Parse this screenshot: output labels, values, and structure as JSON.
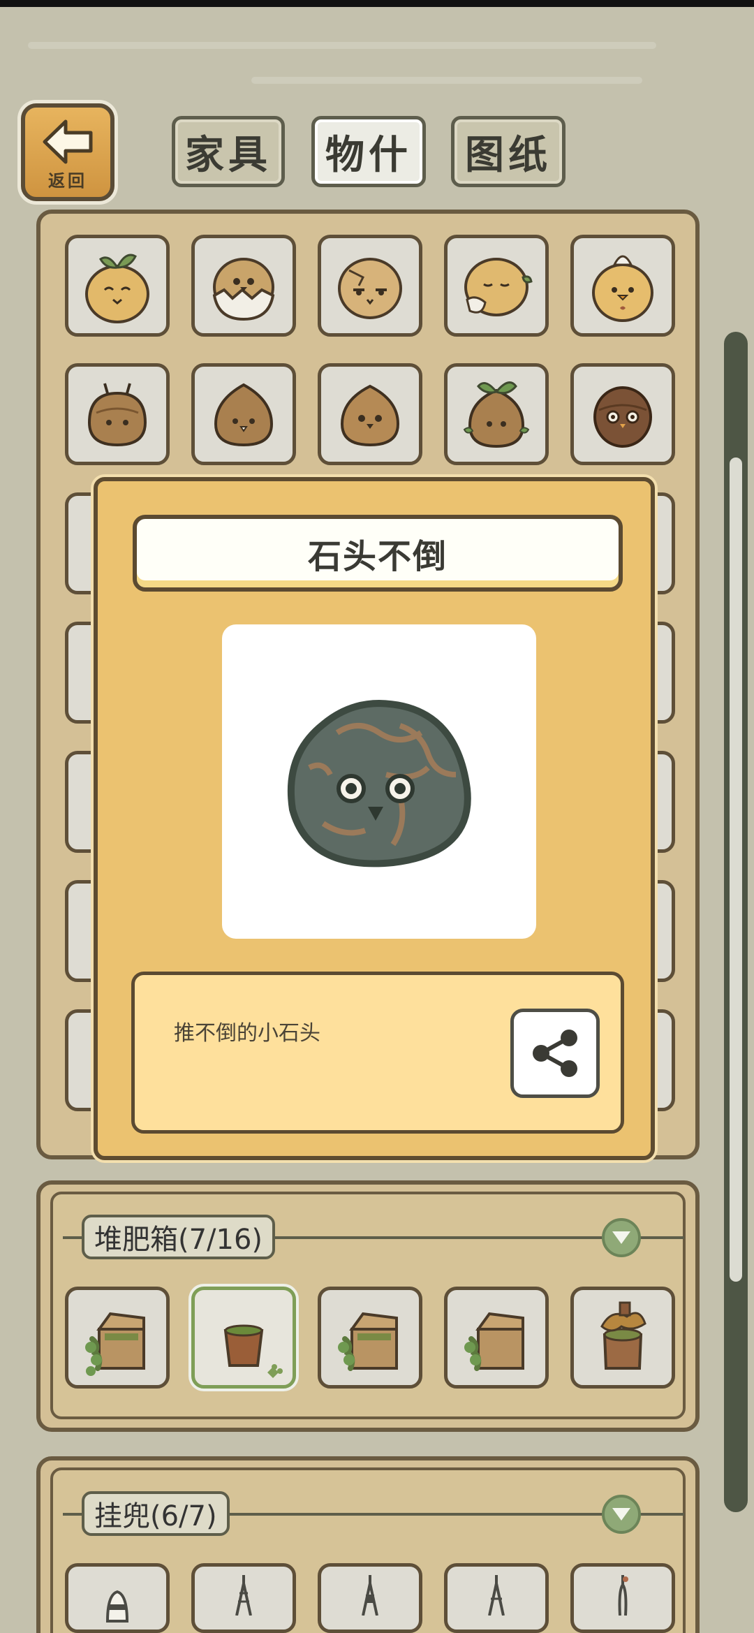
{
  "header": {
    "back_label": "返回",
    "tabs": [
      {
        "label": "家具",
        "active": false
      },
      {
        "label": "物什",
        "active": true
      },
      {
        "label": "图纸",
        "active": false
      }
    ]
  },
  "item_grid": {
    "row1": [
      "sprout-seed-icon",
      "hatching-seed-icon",
      "cracked-seed-icon",
      "sleeping-seed-icon",
      "flower-seed-icon"
    ],
    "row2": [
      "antenna-chestnut-icon",
      "chestnut-icon",
      "owl-chestnut-icon",
      "leaf-chestnut-icon",
      "dark-chestnut-icon"
    ]
  },
  "popup": {
    "title": "石头不倒",
    "description": "推不倒的小石头",
    "image": "owl-stone-icon",
    "share_icon": "share-icon"
  },
  "categories": [
    {
      "label": "堆肥箱(7/16)",
      "toggle_icon": "chevron-down-icon",
      "items": [
        "compost-box-icon",
        "wooden-bucket-icon",
        "compost-box-icon",
        "compost-box-icon",
        "stump-pot-icon"
      ],
      "selected_index": 1
    },
    {
      "label": "挂兜(6/7)",
      "toggle_icon": "chevron-down-icon",
      "items": [
        "hanging-pouch-icon",
        "hanging-pouch-icon",
        "hanging-pouch-icon",
        "hanging-pouch-icon",
        "hanging-pouch-icon"
      ]
    }
  ],
  "colors": {
    "background": "#c4c1ad",
    "popup": "#ebc270",
    "desc_box": "#fee09c",
    "panel": "#d4c096",
    "toggle": "#8fa977"
  }
}
